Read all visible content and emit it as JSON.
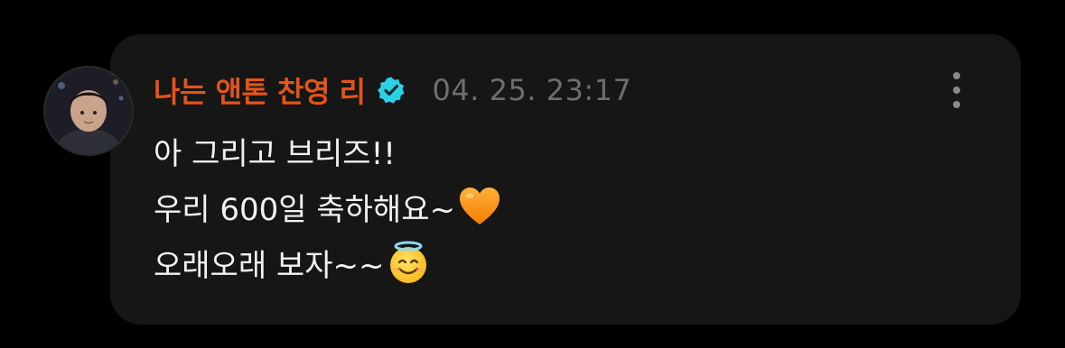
{
  "comment": {
    "author": {
      "name": "나는 앤톤 찬영 리",
      "verified": true,
      "avatar": "avatar-photo",
      "name_color": "#e2541a"
    },
    "timestamp": "04. 25. 23:17",
    "more_icon": "more-vertical-icon",
    "message": {
      "line1": "아 그리고 브리즈!!",
      "line2": "우리 600일 축하해요~",
      "line2_emoji": "orange-heart-emoji",
      "line3": "오래오래 보자~~",
      "line3_emoji": "smiling-face-with-halo-emoji"
    }
  },
  "colors": {
    "background": "#000000",
    "card": "#161616",
    "text": "#f2f2f2",
    "timestamp": "#6e6e6e",
    "verified": "#2bd2e6"
  }
}
